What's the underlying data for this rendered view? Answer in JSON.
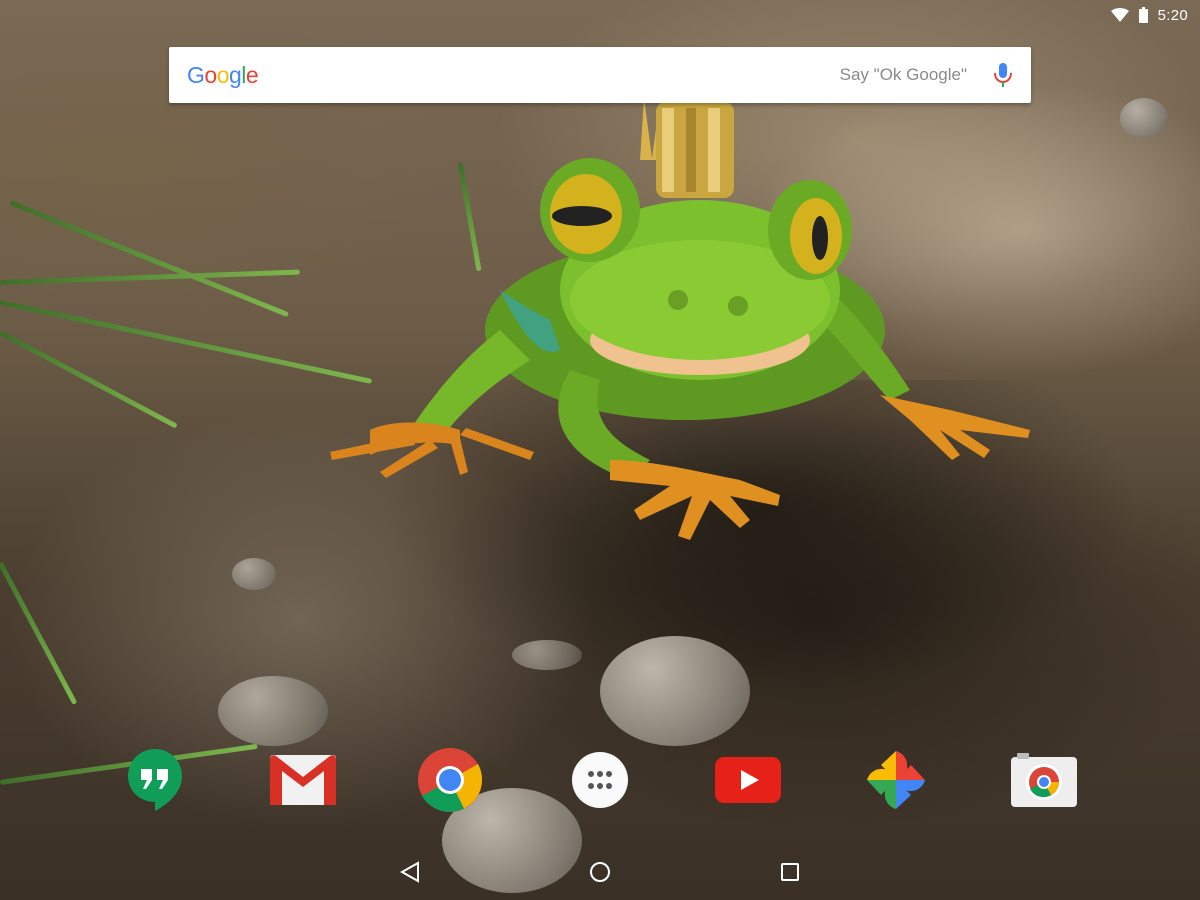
{
  "status_bar": {
    "time": "5:20",
    "icons": [
      "wifi-icon",
      "battery-icon"
    ]
  },
  "search_bar": {
    "logo_text": [
      "G",
      "o",
      "o",
      "g",
      "l",
      "e"
    ],
    "hint": "Say \"Ok Google\"",
    "mic_icon": "mic-icon"
  },
  "dock": {
    "apps": [
      {
        "name": "Hangouts",
        "icon": "hangouts-icon",
        "color": "#0F9D58"
      },
      {
        "name": "Gmail",
        "icon": "gmail-icon",
        "color": "#EA4335"
      },
      {
        "name": "Chrome",
        "icon": "chrome-icon",
        "color": "#4285F4"
      },
      {
        "name": "All apps",
        "icon": "app-drawer-icon",
        "color": "#FFFFFF"
      },
      {
        "name": "YouTube",
        "icon": "youtube-icon",
        "color": "#E62117"
      },
      {
        "name": "Photos",
        "icon": "photos-icon",
        "color": "#FBBC05"
      },
      {
        "name": "Camera",
        "icon": "camera-icon",
        "color": "#4285F4"
      }
    ]
  },
  "nav_bar": {
    "buttons": [
      "back-icon",
      "home-icon",
      "recents-icon"
    ]
  },
  "wallpaper": {
    "subject": "frog-with-crown",
    "colors": {
      "frog": "#7cc02e",
      "eyes": "#d4b21e",
      "feet": "#d9841c",
      "crown": "#c9a640"
    }
  }
}
